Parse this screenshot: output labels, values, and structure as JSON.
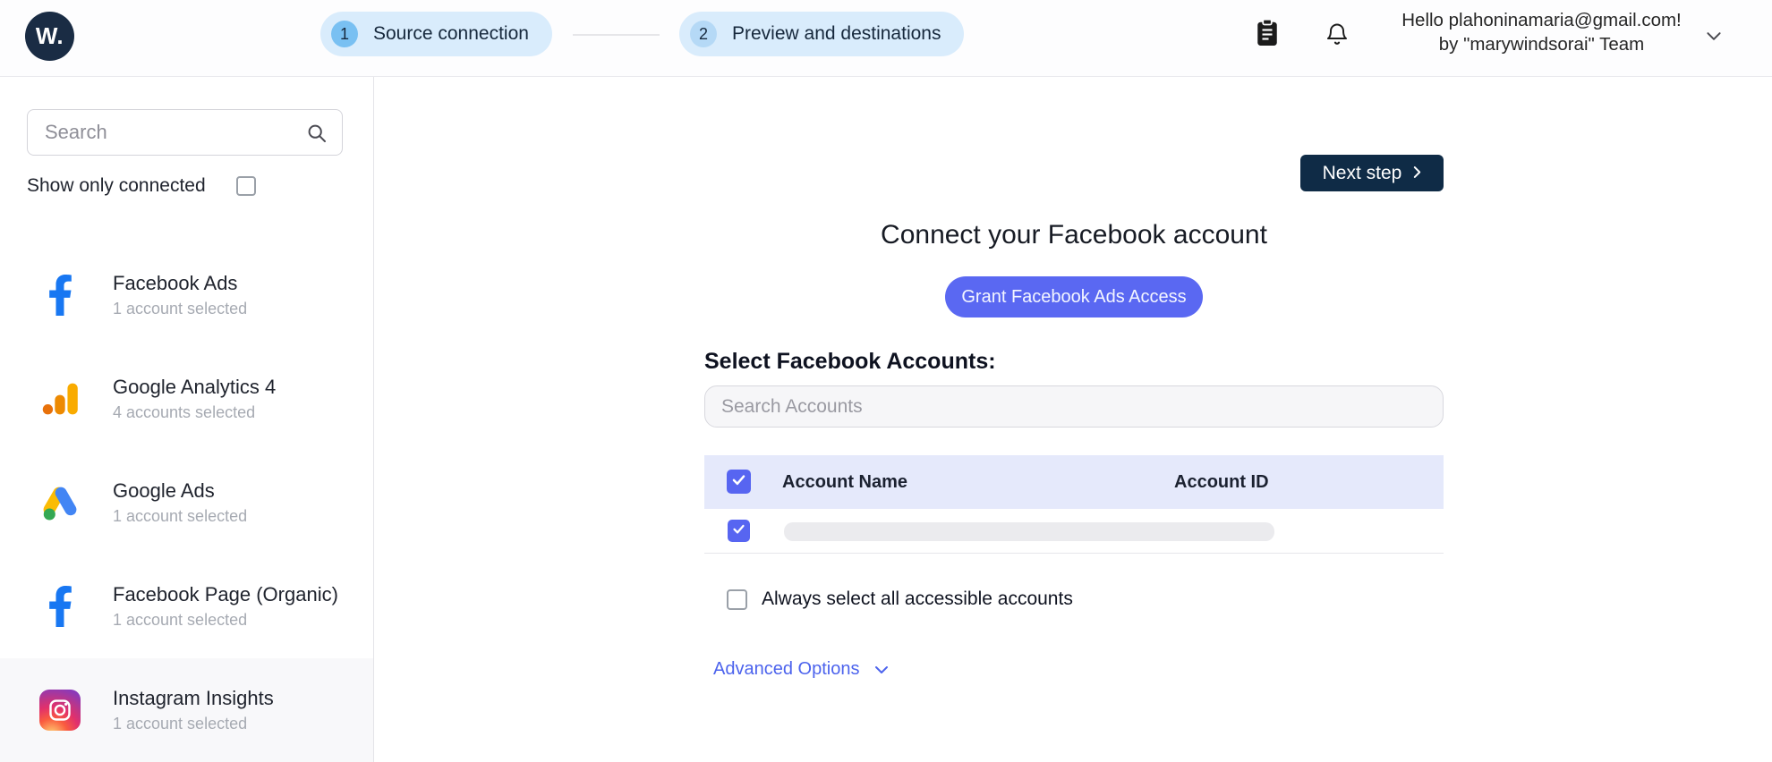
{
  "header": {
    "logo_text": "W.",
    "steps": [
      {
        "number": "1",
        "label": "Source connection"
      },
      {
        "number": "2",
        "label": "Preview and destinations"
      }
    ],
    "greeting": {
      "line1": "Hello plahoninamaria@gmail.com!",
      "line2": "by \"marywindsorai\" Team"
    },
    "icons": [
      "clipboard-icon",
      "notification-bell-icon",
      "chevron-down-icon"
    ]
  },
  "sidebar": {
    "search": {
      "placeholder": "Search",
      "value": ""
    },
    "show_only_connected": {
      "label": "Show only connected",
      "checked": false
    },
    "connectors": [
      {
        "name": "Facebook Ads",
        "status": "1 account selected",
        "icon": "facebook-icon"
      },
      {
        "name": "Google Analytics 4",
        "status": "4 accounts selected",
        "icon": "google-analytics-icon"
      },
      {
        "name": "Google Ads",
        "status": "1 account selected",
        "icon": "google-ads-icon"
      },
      {
        "name": "Facebook Page (Organic)",
        "status": "1 account selected",
        "icon": "facebook-icon"
      },
      {
        "name": "Instagram Insights",
        "status": "1 account selected",
        "icon": "instagram-icon"
      }
    ]
  },
  "main": {
    "next_step": {
      "label": "Next step"
    },
    "title": "Connect your Facebook account",
    "grant_button": {
      "label": "Grant Facebook Ads Access"
    },
    "select_heading": "Select Facebook Accounts:",
    "accounts_search": {
      "placeholder": "Search Accounts",
      "value": ""
    },
    "accounts_table": {
      "columns": [
        "Account Name",
        "Account ID"
      ],
      "select_all_checked": true,
      "rows": [
        {
          "checked": true,
          "account_name_redacted": true,
          "account_id": ""
        }
      ]
    },
    "always_select": {
      "label": "Always select all accessible accounts",
      "checked": false
    },
    "advanced_options": {
      "label": "Advanced Options"
    }
  },
  "colors": {
    "accent_blue": "#5a68f2",
    "navy_button": "#0f2b46",
    "logo_navy": "#1a2c44",
    "step_pill_bg": "#d9ecfc",
    "step1_circle": "#79c0f2",
    "step2_circle": "#b5d9f6",
    "table_header_bg": "#e5e9fb",
    "facebook_blue": "#1877f2",
    "advanced_link": "#4c63ed"
  }
}
